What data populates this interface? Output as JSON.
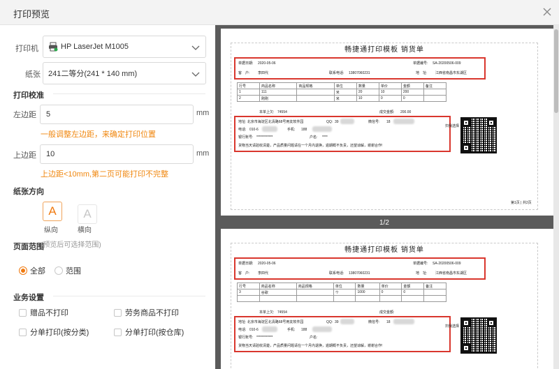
{
  "window": {
    "title": "打印预览"
  },
  "printer": {
    "label": "打印机",
    "value": "HP LaserJet M1005"
  },
  "paper": {
    "label": "纸张",
    "value": "241二等分(241 * 140 mm)"
  },
  "calibration": {
    "section": "打印校准",
    "left_margin": {
      "label": "左边距",
      "value": "5",
      "unit": "mm",
      "hint": "一般调整左边距，来确定打印位置"
    },
    "top_margin": {
      "label": "上边距",
      "value": "10",
      "unit": "mm",
      "hint": "上边距<10mm,第二页可能打印不完整"
    }
  },
  "orientation": {
    "section": "纸张方向",
    "portrait": {
      "glyph": "A",
      "label": "纵向"
    },
    "landscape": {
      "glyph": "A",
      "label": "横向"
    },
    "selected": "portrait"
  },
  "page_range": {
    "section": "页面范围",
    "note": "(预览后可选择范围)",
    "options": [
      "全部",
      "范围"
    ],
    "selected": "全部"
  },
  "business": {
    "section": "业务设置",
    "options": [
      "赠品不打印",
      "劳务商品不打印",
      "分单打印(按分类)",
      "分单打印(按仓库)"
    ]
  },
  "preview": {
    "page_indicator": "1/2",
    "doc": {
      "title": "畅捷通打印模板 销货单",
      "date_label": "单据日期:",
      "date": "2020-05-06",
      "no_label": "单据编号:",
      "no": "SA-20200506-009",
      "customer_label": "客　户:",
      "customer": "李四代",
      "phone_label": "联系电话:",
      "phone": "13807060231",
      "addr_label": "地　址:",
      "addr": "江西省南昌市东湖区",
      "columns": [
        "行号",
        "商品名称",
        "商品规格",
        "单位",
        "数量",
        "单价",
        "金额",
        "备注"
      ],
      "page1_rows": [
        [
          "1",
          "111",
          "",
          "米",
          "20",
          "10",
          "200",
          ""
        ],
        [
          "2",
          "刚刚",
          "",
          "米",
          "10",
          "0",
          "0",
          ""
        ]
      ],
      "page2_rows": [
        [
          "3",
          "谷歌",
          "",
          "个",
          "1000",
          "0",
          "0",
          ""
        ]
      ],
      "subtotal_label": "本单上欠:",
      "subtotal": "74554",
      "deal_label": "成交金额:",
      "deal": "200.00",
      "company_addr": "地址: 北京市海淀区北清路68号用友软件园",
      "qq_label": "QQ:",
      "qq": "39",
      "wechat_label": "微信号:",
      "wechat": "18",
      "tel_label": "电话:",
      "tel": "010-6",
      "mobile_label": "手机:",
      "mobile": "188",
      "account_label": "银行账号:",
      "account": "************",
      "account_name_label": "户名:",
      "account_name": "****",
      "notice": "货物当天请验收清楚，产品质量问题请在一个月内退换，逾期概不负责，还望谅解，谢谢合作!",
      "scan_note": "扫我选择",
      "page_footer": "第1页 | 共2页"
    }
  }
}
